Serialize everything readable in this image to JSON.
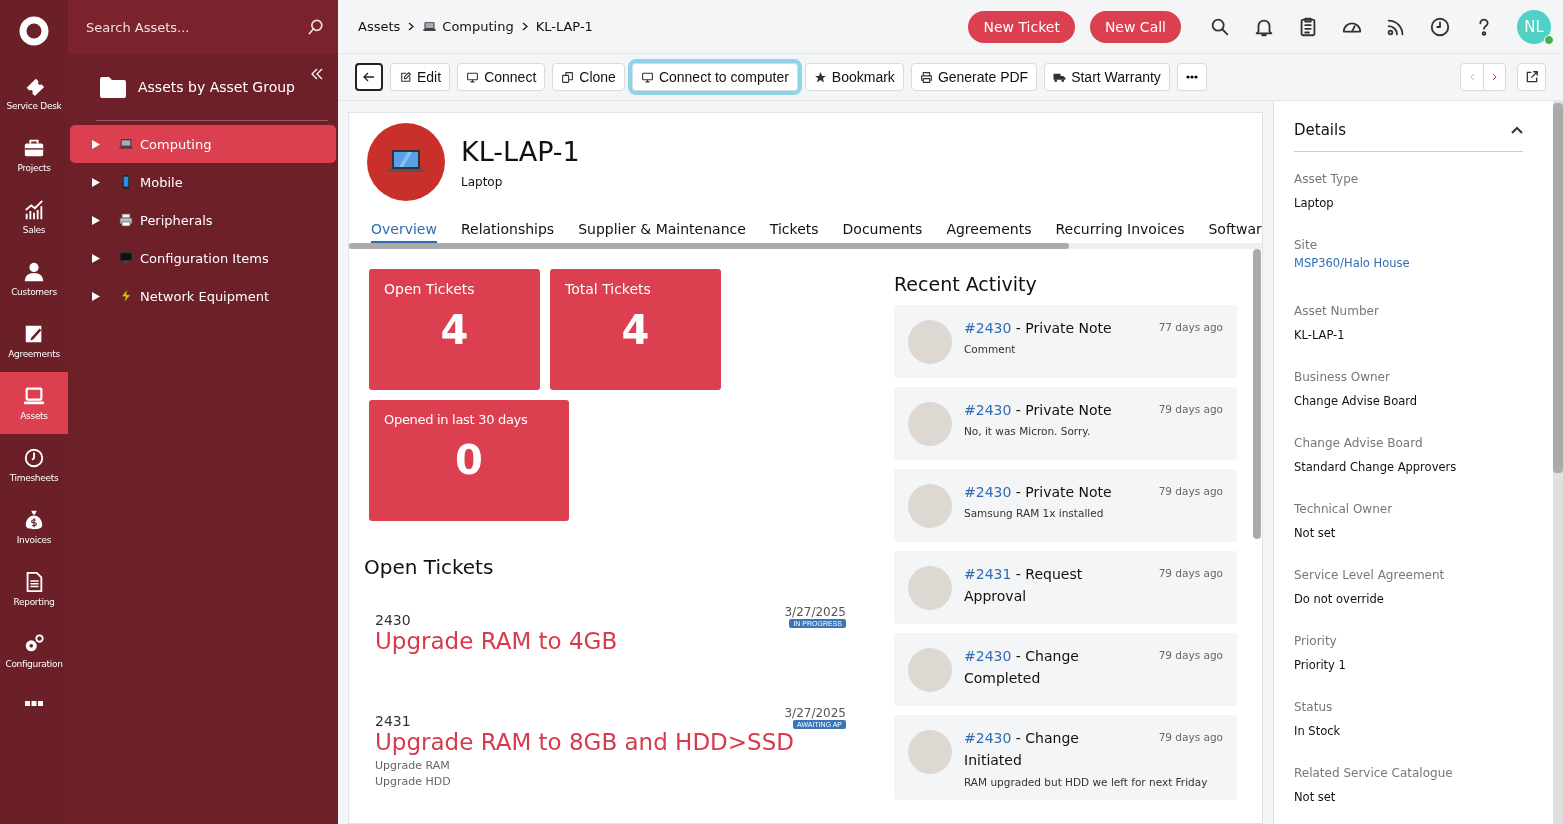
{
  "rail": {
    "items": [
      {
        "label": "Service Desk",
        "selected": false
      },
      {
        "label": "Projects",
        "selected": false
      },
      {
        "label": "Sales",
        "selected": false
      },
      {
        "label": "Customers",
        "selected": false
      },
      {
        "label": "Agreements",
        "selected": false
      },
      {
        "label": "Assets",
        "selected": true
      },
      {
        "label": "Timesheets",
        "selected": false
      },
      {
        "label": "Invoices",
        "selected": false
      },
      {
        "label": "Reporting",
        "selected": false
      },
      {
        "label": "Configuration",
        "selected": false
      }
    ]
  },
  "tree": {
    "search": {
      "placeholder": "Search Assets..."
    },
    "title": "Assets by Asset Group",
    "items": [
      {
        "label": "Computing",
        "kind": "laptop",
        "selected": true
      },
      {
        "label": "Mobile",
        "kind": "phone",
        "selected": false
      },
      {
        "label": "Peripherals",
        "kind": "printer",
        "selected": false
      },
      {
        "label": "Configuration Items",
        "kind": "monitor",
        "selected": false
      },
      {
        "label": "Network Equipment",
        "kind": "bolt",
        "selected": false
      }
    ]
  },
  "breadcrumb": [
    "Assets",
    "Computing",
    "KL-LAP-1"
  ],
  "header": {
    "buttons": [
      "New Ticket",
      "New Call"
    ],
    "user": {
      "initials": "NL",
      "online": true
    }
  },
  "toolbar": {
    "buttons": [
      {
        "label": "Edit",
        "kind": "edit",
        "focused": false
      },
      {
        "label": "Connect",
        "kind": "monitor",
        "focused": false
      },
      {
        "label": "Clone",
        "kind": "clone",
        "focused": false
      },
      {
        "label": "Connect to computer",
        "kind": "monitor",
        "focused": true
      },
      {
        "label": "Bookmark",
        "kind": "star",
        "focused": false
      },
      {
        "label": "Generate PDF",
        "kind": "printer",
        "focused": false
      },
      {
        "label": "Start Warranty",
        "kind": "truck",
        "focused": false
      }
    ],
    "prev_disabled": true,
    "next_disabled": false
  },
  "asset": {
    "name": "KL-LAP-1",
    "type": "Laptop"
  },
  "tabs": [
    {
      "label": "Overview",
      "selected": true
    },
    {
      "label": "Relationships",
      "selected": false
    },
    {
      "label": "Supplier & Maintenance",
      "selected": false
    },
    {
      "label": "Tickets",
      "selected": false
    },
    {
      "label": "Documents",
      "selected": false
    },
    {
      "label": "Agreements",
      "selected": false
    },
    {
      "label": "Recurring Invoices",
      "selected": false
    },
    {
      "label": "Softwar",
      "selected": false
    }
  ],
  "stats": [
    {
      "label": "Open Tickets",
      "value": "4"
    },
    {
      "label": "Total Tickets",
      "value": "4"
    },
    {
      "label": "Opened in last 30 days",
      "value": "0"
    }
  ],
  "open_tickets": {
    "title": "Open Tickets",
    "items": [
      {
        "number": "2430",
        "title": "Upgrade RAM to 4GB",
        "date": "3/27/2025",
        "status": "IN PROGRESS"
      },
      {
        "number": "2431",
        "title": "Upgrade RAM to 8GB and HDD>SSD",
        "date": "3/27/2025",
        "status": "AWAITING AP",
        "details": [
          "Upgrade RAM",
          "Upgrade HDD"
        ]
      }
    ]
  },
  "recent_activity": {
    "title": "Recent Activity",
    "items": [
      {
        "ref": "#2430",
        "title": " - Private Note",
        "time": "77 days ago",
        "note": "Comment"
      },
      {
        "ref": "#2430",
        "title": " - Private Note",
        "time": "79 days ago",
        "note": "No, it was Micron. Sorry."
      },
      {
        "ref": "#2430",
        "title": " - Private Note",
        "time": "79 days ago",
        "note": "Samsung RAM 1x installed"
      },
      {
        "ref": "#2431",
        "title": " - Request Approval",
        "time": "79 days ago"
      },
      {
        "ref": "#2430",
        "title": " - Change Completed",
        "time": "79 days ago"
      },
      {
        "ref": "#2430",
        "title": " - Change Initiated",
        "time": "79 days ago",
        "note": "RAM upgraded but HDD we left for next Friday"
      }
    ]
  },
  "details": {
    "title": "Details",
    "expanded": true,
    "fields": [
      {
        "label": "Asset Type",
        "value": "Laptop",
        "link": false
      },
      {
        "label": "Site",
        "value": "MSP360/Halo House",
        "link": true
      },
      {
        "label": "Asset Number",
        "value": "KL-LAP-1",
        "link": false
      },
      {
        "label": "Business Owner",
        "value": "Change Advise Board",
        "link": false
      },
      {
        "label": "Change Advise Board",
        "value": "Standard Change Approvers",
        "link": false
      },
      {
        "label": "Technical Owner",
        "value": "Not set",
        "link": false
      },
      {
        "label": "Service Level Agreement",
        "value": "Do not override",
        "link": false
      },
      {
        "label": "Priority",
        "value": "Priority 1",
        "link": false
      },
      {
        "label": "Status",
        "value": "In Stock",
        "link": false
      },
      {
        "label": "Related Service Catalogue",
        "value": "Not set",
        "link": false
      }
    ]
  }
}
